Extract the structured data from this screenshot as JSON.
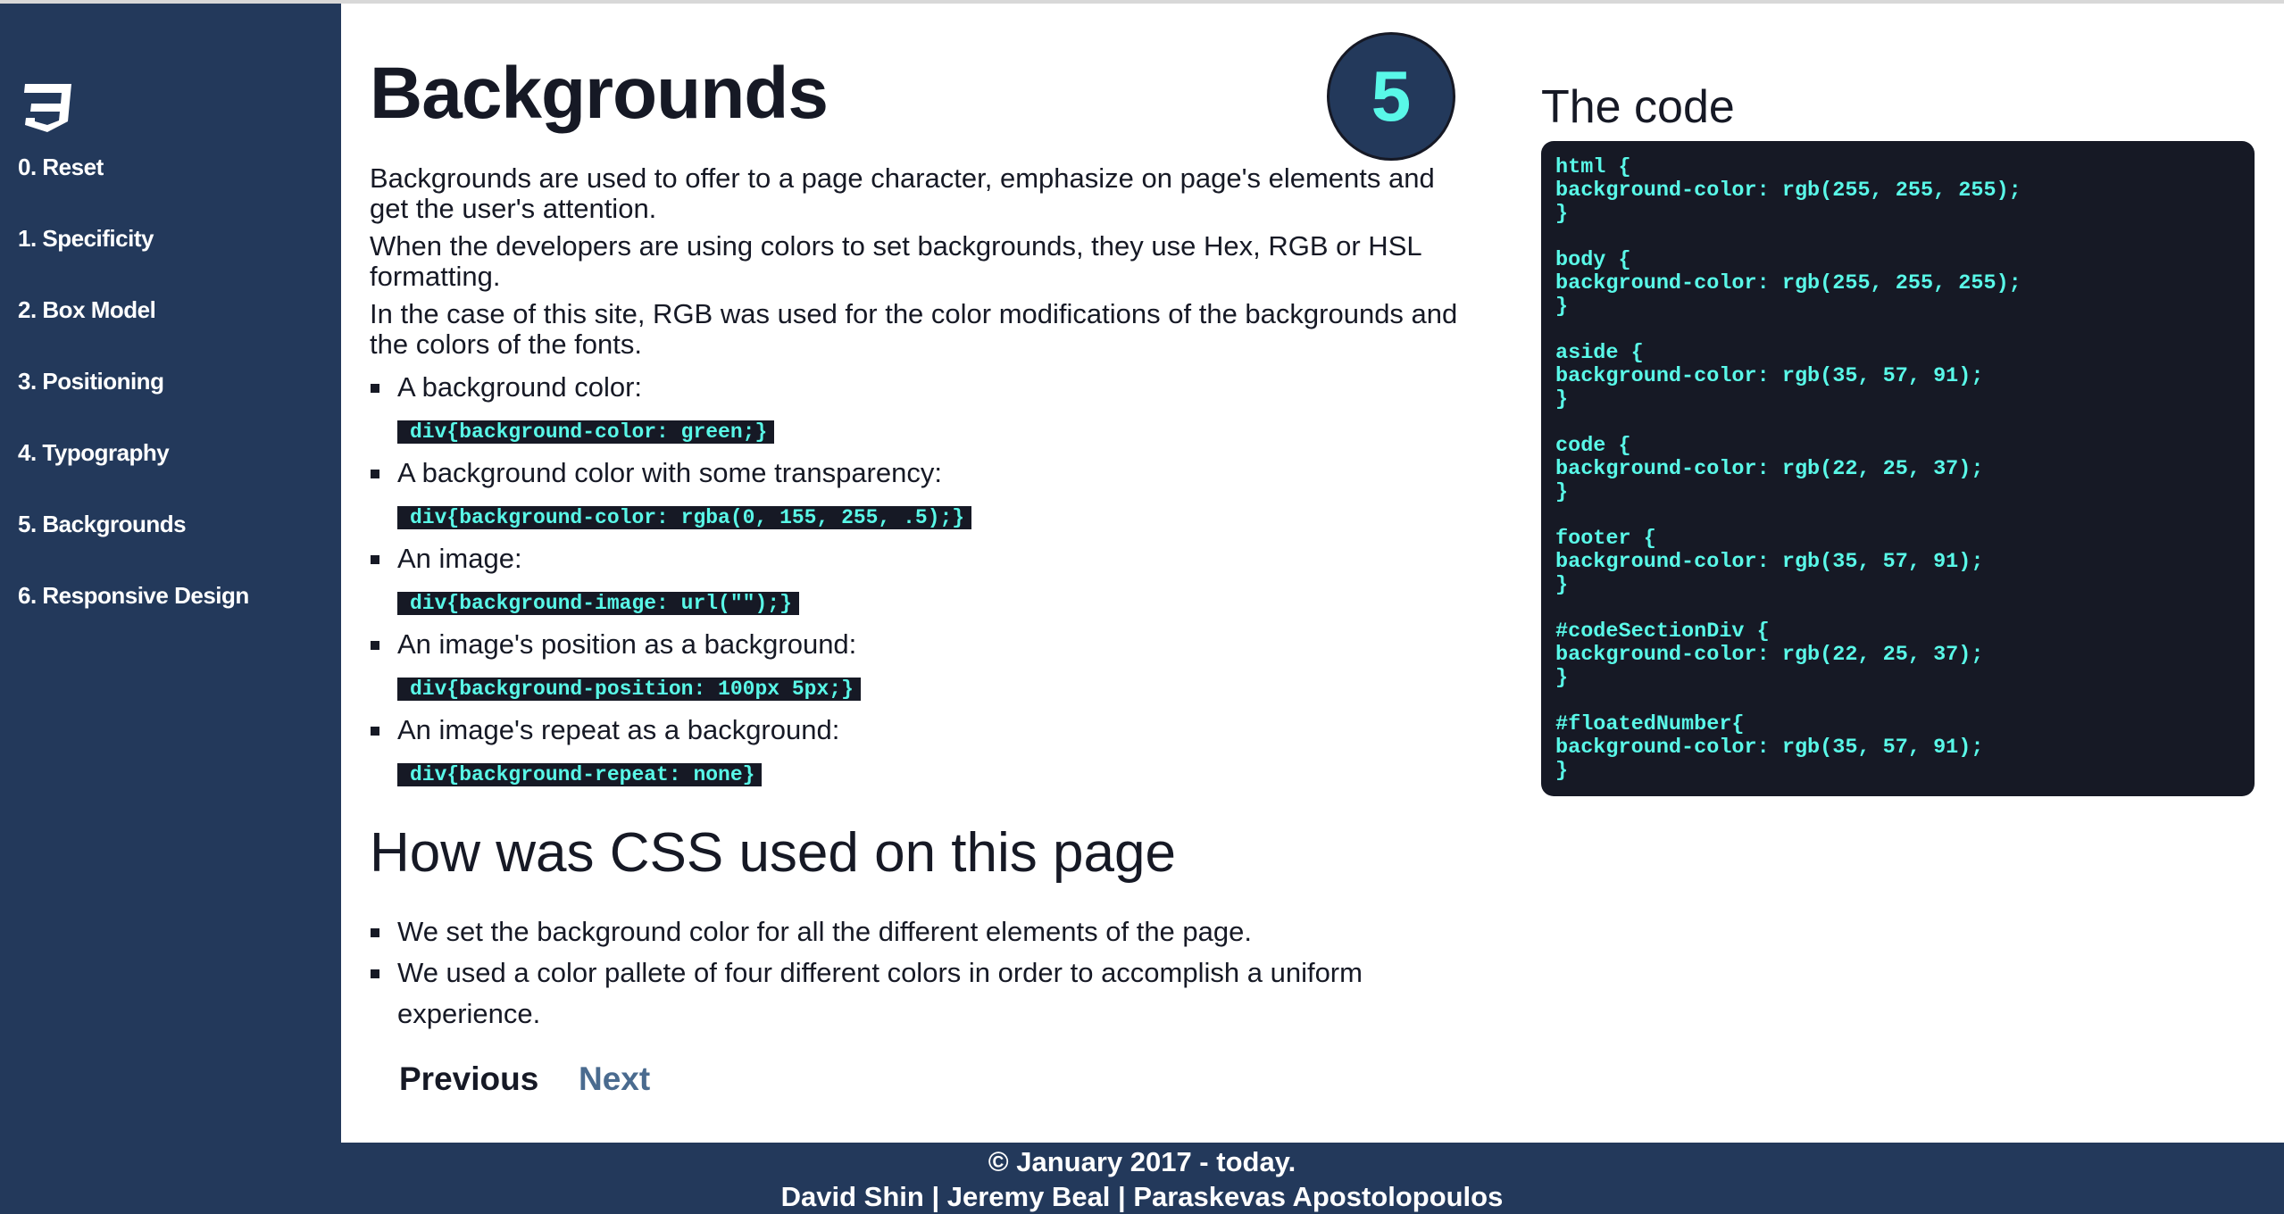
{
  "sidebar": {
    "logo": "CSS3 logo",
    "items": [
      {
        "label": "0. Reset"
      },
      {
        "label": "1. Specificity"
      },
      {
        "label": "2. Box Model"
      },
      {
        "label": "3. Positioning"
      },
      {
        "label": "4. Typography"
      },
      {
        "label": "5. Backgrounds"
      },
      {
        "label": "6. Responsive Design"
      }
    ]
  },
  "main": {
    "title": "Backgrounds",
    "section_number": "5",
    "paragraphs": [
      "Backgrounds are used to offer to a page character, emphasize on page's elements and get the user's attention.",
      "When the developers are using colors to set backgrounds, they use Hex, RGB or HSL formatting.",
      "In the case of this site, RGB was used for the color modifications of the backgrounds and the colors of the fonts."
    ],
    "examples": [
      {
        "label": "A background color:",
        "code": "div{background-color: green;}"
      },
      {
        "label": "A background color with some transparency:",
        "code": "div{background-color: rgba(0, 155, 255, .5);}"
      },
      {
        "label": "An image:",
        "code": "div{background-image: url(\"\");}"
      },
      {
        "label": "An image's position as a background:",
        "code": "div{background-position: 100px 5px;}"
      },
      {
        "label": "An image's repeat as a background:",
        "code": "div{background-repeat: none}"
      }
    ],
    "subtitle": "How was CSS used on this page",
    "usage": [
      "We set the background color for all the different elements of the page.",
      "We used a color pallete of four different colors in order to accomplish a uniform experience."
    ],
    "previous_label": "Previous",
    "next_label": "Next"
  },
  "code_section": {
    "title": "The code",
    "blocks": [
      {
        "selector": "html {",
        "rule": "background-color: rgb(255, 255, 255);",
        "close": "}"
      },
      {
        "selector": "body {",
        "rule": "background-color: rgb(255, 255, 255);",
        "close": "}"
      },
      {
        "selector": "aside {",
        "rule": "background-color: rgb(35, 57, 91);",
        "close": "}"
      },
      {
        "selector": "code {",
        "rule": "background-color: rgb(22, 25, 37);",
        "close": "}"
      },
      {
        "selector": "footer {",
        "rule": "background-color: rgb(35, 57, 91);",
        "close": "}"
      },
      {
        "selector": "#codeSectionDiv {",
        "rule": "background-color: rgb(22, 25, 37);",
        "close": "}"
      },
      {
        "selector": "#floatedNumber{",
        "rule": "background-color: rgb(35, 57, 91);",
        "close": "}"
      }
    ]
  },
  "footer": {
    "line1": "© January 2017 - today.",
    "line2": "David Shin | Jeremy Beal | Paraskevas Apostolopoulos"
  },
  "colors": {
    "sidebar": "#23395b",
    "code_bg": "#161925",
    "code_text": "#59f8e8",
    "link_next": "#4a6b8f"
  }
}
